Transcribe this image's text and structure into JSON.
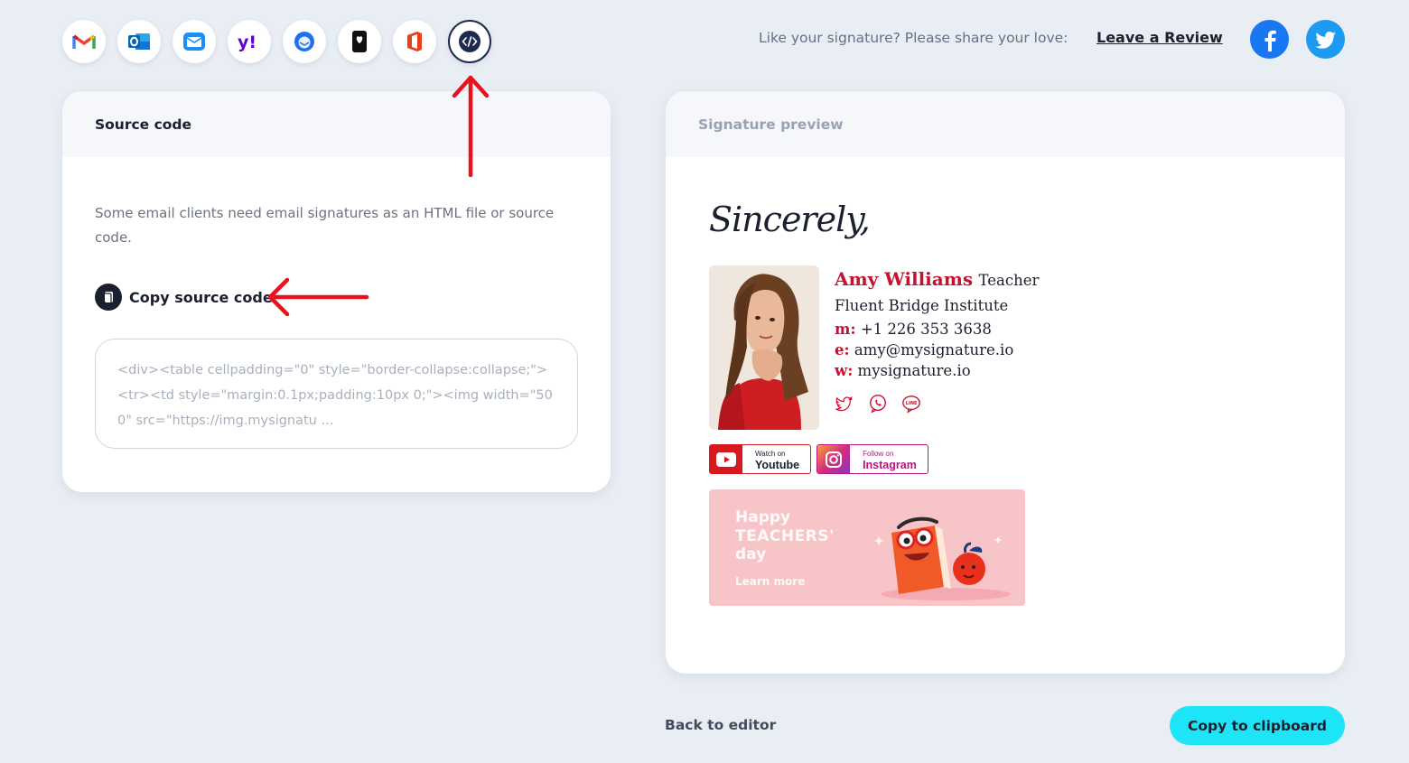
{
  "clients": [
    {
      "name": "gmail",
      "active": false
    },
    {
      "name": "outlook",
      "active": false
    },
    {
      "name": "apple-mail",
      "active": false
    },
    {
      "name": "yahoo",
      "active": false
    },
    {
      "name": "thunderbird",
      "active": false
    },
    {
      "name": "apple-ios",
      "active": false
    },
    {
      "name": "office-365",
      "active": false
    },
    {
      "name": "html-source",
      "active": true
    }
  ],
  "header": {
    "share_text": "Like your signature? Please share your love:",
    "review_link": "Leave a Review"
  },
  "source_panel": {
    "title": "Source code",
    "description": "Some email clients need email signatures as an HTML file or source code.",
    "copy_label": "Copy source code",
    "code_preview": "<div><table cellpadding=\"0\" style=\"border-collapse:collapse;\"><tr><td style=\"margin:0.1px;padding:10px 0;\"><img width=\"500\" src=\"https://img.mysignatu ..."
  },
  "preview_panel": {
    "title": "Signature preview",
    "signoff": "Sincerely,",
    "name": "Amy Williams",
    "role": "Teacher",
    "institution": "Fluent Bridge Institute",
    "phone_key": "m:",
    "phone": "+1 226 353 3638",
    "email_key": "e:",
    "email": "amy@mysignature.io",
    "web_key": "w:",
    "website": "mysignature.io",
    "social_icons": [
      "twitter-icon",
      "viber-icon",
      "line-icon"
    ],
    "youtube_small": "Watch on",
    "youtube_big": "Youtube",
    "instagram_small": "Follow on",
    "instagram_big": "Instagram",
    "banner_line1": "Happy",
    "banner_line2": "TEACHERS'",
    "banner_line3": "day",
    "banner_cta": "Learn more"
  },
  "footer": {
    "back_label": "Back to editor",
    "copy_label": "Copy to clipboard"
  },
  "colors": {
    "accent": "#1ee4f7",
    "name_red": "#c8102e",
    "background": "#e9edf4",
    "annotation": "#e8121f"
  }
}
